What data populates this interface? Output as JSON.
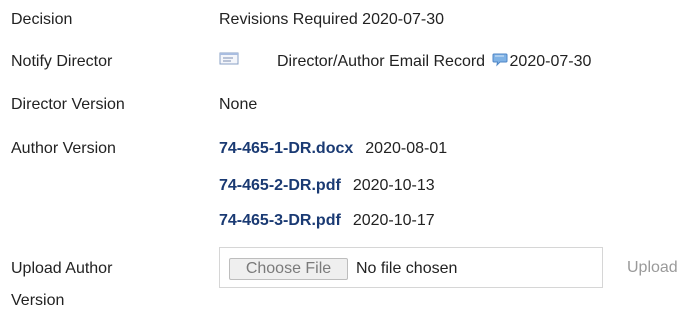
{
  "rows": {
    "decision": {
      "label": "Decision",
      "value": "Revisions Required 2020-07-30"
    },
    "notify": {
      "label": "Notify Director",
      "link_text": "Director/Author Email Record",
      "date": "2020-07-30",
      "icons": [
        "envelope-icon",
        "comment-bubble-icon"
      ]
    },
    "director_version": {
      "label": "Director Version",
      "value": "None"
    },
    "author_version": {
      "label": "Author Version",
      "files": [
        {
          "name": "74-465-1-DR.docx",
          "date": "2020-08-01"
        },
        {
          "name": "74-465-2-DR.pdf",
          "date": "2020-10-13"
        },
        {
          "name": "74-465-3-DR.pdf",
          "date": "2020-10-17"
        }
      ]
    },
    "upload": {
      "label_line1": "Upload Author",
      "label_line2": "Version",
      "choose_label": "Choose File",
      "no_file_text": "No file chosen",
      "upload_label": "Upload"
    }
  },
  "colors": {
    "link": "#1a3a73",
    "text": "#222222",
    "muted": "#9a9a9a",
    "bubble": "#7fb2e5"
  }
}
